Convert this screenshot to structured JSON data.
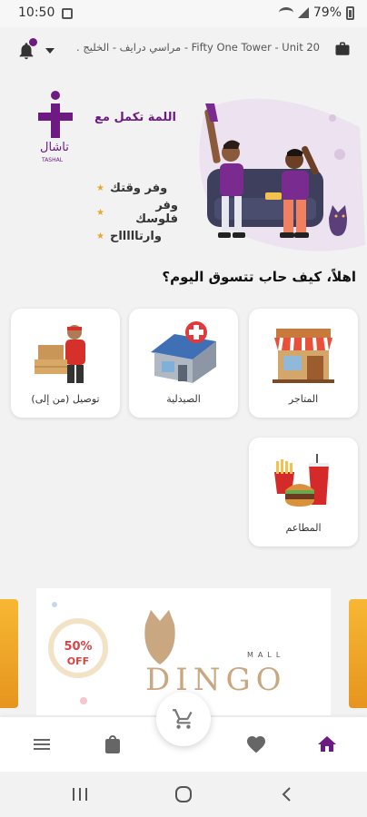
{
  "status_bar": {
    "time": "10:50",
    "battery": "79%",
    "icons": [
      "gallery-icon",
      "download-icon",
      "wifi-icon",
      "signal-icon",
      "battery-icon"
    ]
  },
  "header": {
    "location": "Fifty One Tower - Unit 20 - مراسي درايف - الخليج ...",
    "icons": [
      "bell-icon",
      "dropdown-icon",
      "bag-icon"
    ],
    "accent_color": "#6d1b83"
  },
  "banner": {
    "brand_name": "TASHAL",
    "tagline": "اللمة تكمل مع",
    "perks": [
      "وفر وقتك",
      "وفر فلوسك",
      "وارتاااااح"
    ]
  },
  "greeting": "اهلاً، كيف حاب تتسوق اليوم؟",
  "categories": [
    {
      "label": "المتاجر",
      "icon": "store-icon"
    },
    {
      "label": "الصيدلية",
      "icon": "pharmacy-icon"
    },
    {
      "label": "توصيل (من إلى)",
      "icon": "delivery-icon"
    },
    {
      "label": "المطاعم",
      "icon": "restaurants-icon"
    }
  ],
  "promo": {
    "discount": "50%",
    "discount_word": "OFF",
    "brand": "DINGO",
    "brand_sub": "MALL"
  },
  "bottom_nav": {
    "items": [
      "home-icon",
      "favorites-icon",
      "orders-icon",
      "menu-icon"
    ],
    "cart_icon": "cart-icon"
  },
  "system_nav": [
    "recents-icon",
    "home-circle-icon",
    "back-icon"
  ]
}
